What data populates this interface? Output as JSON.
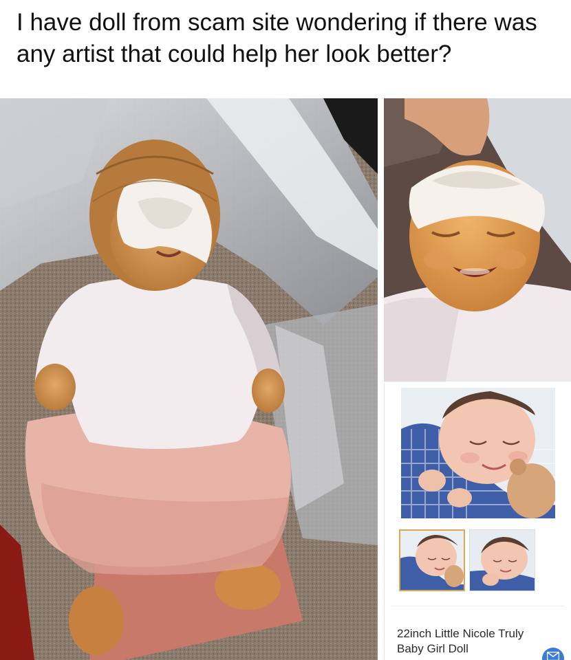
{
  "caption": {
    "text": "I have doll from scam site wondering if there was any artist that could help her look better?"
  },
  "listing": {
    "product_title": "22inch Little Nicole Truly Baby Girl Doll",
    "accent_color": "#d9a65a",
    "mail_button_color": "#3c7bd8",
    "mail_icon": "envelope-icon"
  }
}
